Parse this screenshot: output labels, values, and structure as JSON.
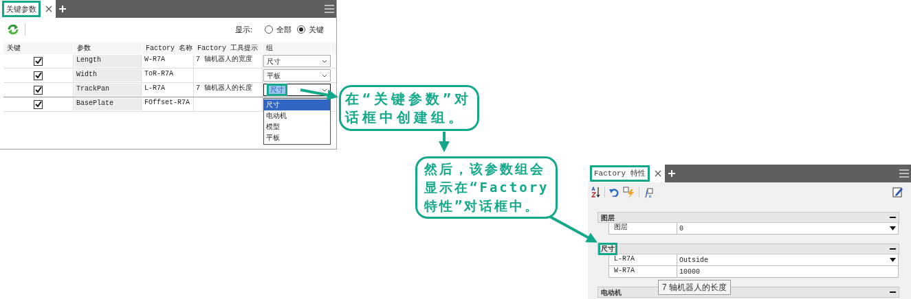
{
  "key_params_panel": {
    "tab": {
      "label": "关键参数",
      "selected": true
    },
    "show_label": "显示:",
    "show_options": [
      {
        "label": "全部",
        "selected": false
      },
      {
        "label": "关键",
        "selected": true
      }
    ],
    "table": {
      "columns": [
        "关键",
        "参数",
        "Factory 名称",
        "Factory 工具提示",
        "组"
      ],
      "rows": [
        {
          "checked": true,
          "parameter": "Length",
          "factory_name": "W-R7A",
          "tooltip": "7 轴机器人的宽度",
          "group": "尺寸",
          "editing": false
        },
        {
          "checked": true,
          "parameter": "Width",
          "factory_name": "ToR-R7A",
          "tooltip": "",
          "group": "平板",
          "editing": false
        },
        {
          "checked": true,
          "parameter": "TrackPan",
          "factory_name": "L-R7A",
          "tooltip": "7 轴机器人的长度",
          "group": "尺寸",
          "editing": true
        },
        {
          "checked": true,
          "parameter": "BasePlate",
          "factory_name": "FOffset-R7A",
          "tooltip": "",
          "group": "",
          "editing": false
        }
      ]
    },
    "group_dropdown": [
      {
        "label": "尺寸",
        "selected": true
      },
      {
        "label": "电动机",
        "selected": false
      },
      {
        "label": "模型",
        "selected": false
      },
      {
        "label": "平板",
        "selected": false
      }
    ]
  },
  "callouts": [
    "在“关键参数”对话框中创建组。",
    "然后，该参数组会显示在“Factory 特性”对话框中。"
  ],
  "factory_properties_panel": {
    "tab": {
      "label": "Factory 特性",
      "selected": true
    },
    "sections": [
      {
        "title": "图层",
        "rows": [
          {
            "name": "图层",
            "value": "0",
            "kind": "dropdown"
          }
        ]
      },
      {
        "title": "尺寸",
        "rows": [
          {
            "name": "L-R7A",
            "value": "Outside",
            "kind": "dropdown"
          },
          {
            "name": "W-R7A",
            "value": "10000",
            "kind": "text"
          }
        ]
      },
      {
        "title": "电动机"
      }
    ],
    "tooltip": "7 轴机器人的长度"
  }
}
